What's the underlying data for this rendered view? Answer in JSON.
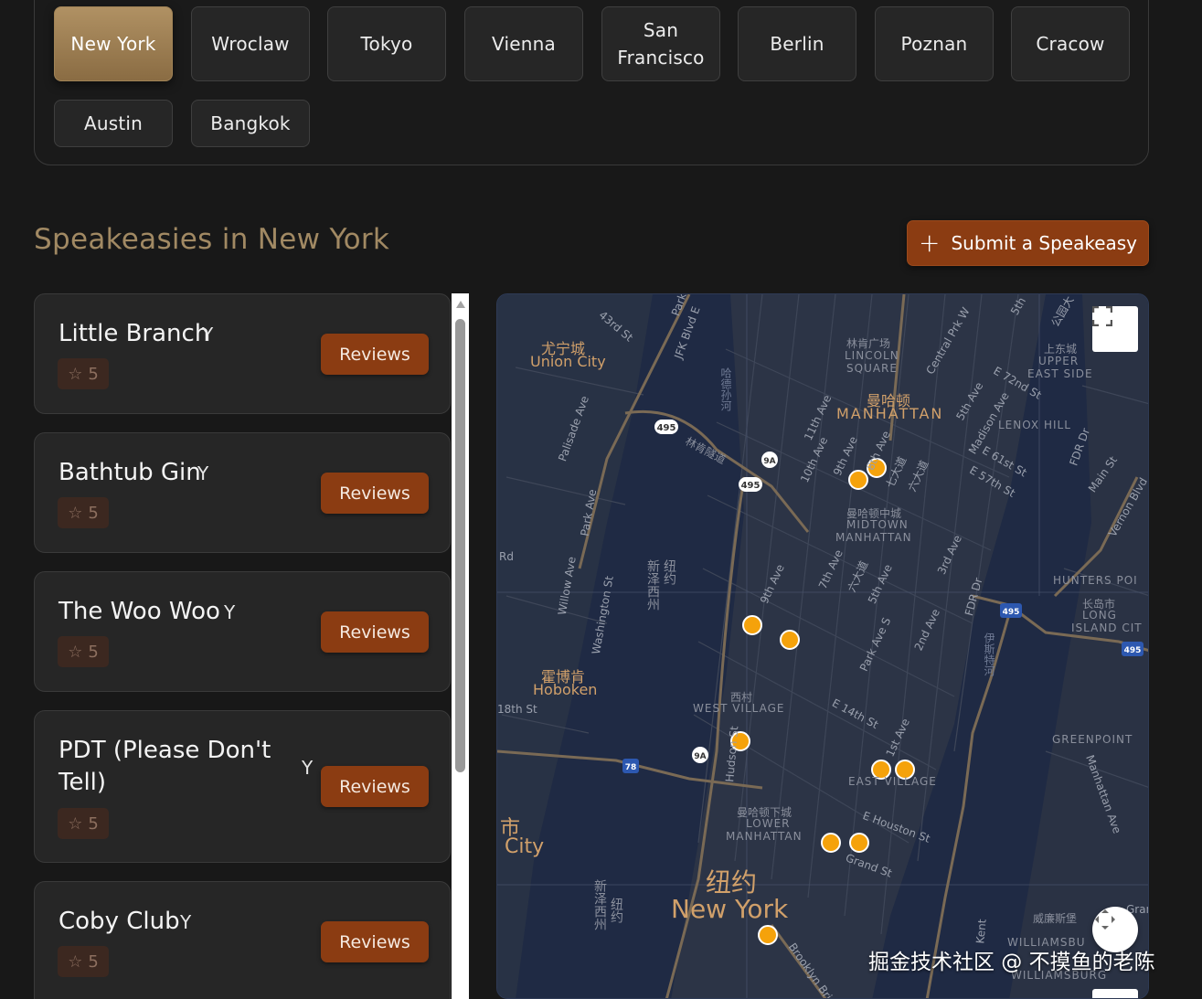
{
  "cities": {
    "row1": [
      "New York",
      "Wroclaw",
      "Tokyo",
      "Vienna",
      "San Francisco",
      "Berlin",
      "Poznan",
      "Cracow"
    ],
    "row2": [
      "Austin",
      "Bangkok"
    ],
    "selected": "New York"
  },
  "heading": {
    "title": "Speakeasies in New York",
    "submit_label": "Submit a Speakeasy",
    "submit_icon": "plus-icon"
  },
  "speakeasies": [
    {
      "name": "Little Branch",
      "rating": "5",
      "reviews_label": "Reviews"
    },
    {
      "name": "Bathtub Gin",
      "rating": "5",
      "reviews_label": "Reviews"
    },
    {
      "name": "The Woo Woo",
      "rating": "5",
      "reviews_label": "Reviews"
    },
    {
      "name": "PDT (Please Don't Tell)",
      "rating": "5",
      "reviews_label": "Reviews"
    },
    {
      "name": "Coby Club",
      "rating": "5",
      "reviews_label": "Reviews"
    }
  ],
  "map": {
    "labels": {
      "union_city_zh": "尤宁城",
      "union_city": "Union City",
      "lincoln_sq_zh": "林肯广场",
      "lincoln_sq_1": "LINCOLN",
      "lincoln_sq_2": "SQUARE",
      "manhattan_zh": "曼哈顿",
      "manhattan": "MANHATTAN",
      "ues_zh": "上东城",
      "ues_1": "UPPER",
      "ues_2": "EAST SIDE",
      "lenox": "LENOX HILL",
      "midtown_zh": "曼哈顿中城",
      "midtown_1": "MIDTOWN",
      "midtown_2": "MANHATTAN",
      "hunters": "HUNTERS POI",
      "lic_zh": "长岛市",
      "lic_1": "LONG",
      "lic_2": "ISLAND CIT",
      "hoboken_zh": "霍博肯",
      "hoboken": "Hoboken",
      "wv_zh": "西村",
      "wv": "WEST VILLAGE",
      "ev": "EAST VILLAGE",
      "greenpoint": "GREENPOINT",
      "lm_zh": "曼哈顿下城",
      "lm_1": "LOWER",
      "lm_2": "MANHATTAN",
      "ny_zh": "纽约",
      "ny": "New York",
      "jc_zh": "市",
      "jc": "City",
      "wb_zh": "威廉斯堡",
      "wb_1": "WILLIAMSBU",
      "wb_2": "WILLIAMSBURG",
      "nj1": "新泽西州",
      "nj1b": "纽约",
      "nj2": "新泽西州",
      "nj2b": "纽约",
      "hwy_495": "495",
      "hwy_9a": "9A",
      "hwy_78": "78",
      "lincoln_tunnel": "林肯隧道",
      "hudson": "哈德孙河",
      "east_river": "伊斯特河",
      "granite": "Grand"
    },
    "streets": {
      "s43": "43rd St",
      "jfk": "JFK Blvd E",
      "park": "Park",
      "palisade": "Palisade Ave",
      "parkave_nj": "Park Ave",
      "willow": "Willow Ave",
      "washington": "Washington St",
      "rd": "Rd",
      "s18": "18th St",
      "s11": "11th Ave",
      "s10": "10th Ave",
      "s9": "9th Ave",
      "s8": "8th Ave",
      "s7": "7th Ave",
      "s7zh": "七大道",
      "s6zh": "六大道",
      "s5": "5th Ave",
      "cpw": "Central Prk W",
      "s5ave": "5th Ave",
      "madison": "Madison Ave",
      "e72": "E 72nd St",
      "e61": "E 61st St",
      "e57": "E 57th St",
      "fdr": "FDR Dr",
      "main": "Main St",
      "vernon": "Vernon Blvd",
      "s3": "3rd Ave",
      "s2": "2nd Ave",
      "parks": "Park Ave S",
      "s9b": "9th Ave",
      "s7b": "7th Ave",
      "e14": "E 14th St",
      "s1": "1st Ave",
      "hudson_st": "Hudson St",
      "ehouston": "E Houston St",
      "grand": "Grand St",
      "kent": "Kent",
      "brooklyn": "Brooklyn Bri",
      "manhattan_ave": "Manhattan Ave",
      "fdr2": "FDR Dr",
      "s5b": "5th",
      "zh_top": "公园大"
    },
    "markers": 12,
    "marker_color": "#f5a20b",
    "fullscreen_icon": "fullscreen-icon",
    "pan_icon": "pan-control-icon"
  },
  "watermark": "掘金技术社区 @ 不摸鱼的老陈",
  "colors": {
    "accent": "#8b3c12",
    "gold": "#a18963",
    "background": "#181818",
    "card": "#262626",
    "map_water": "#1f2a44"
  }
}
